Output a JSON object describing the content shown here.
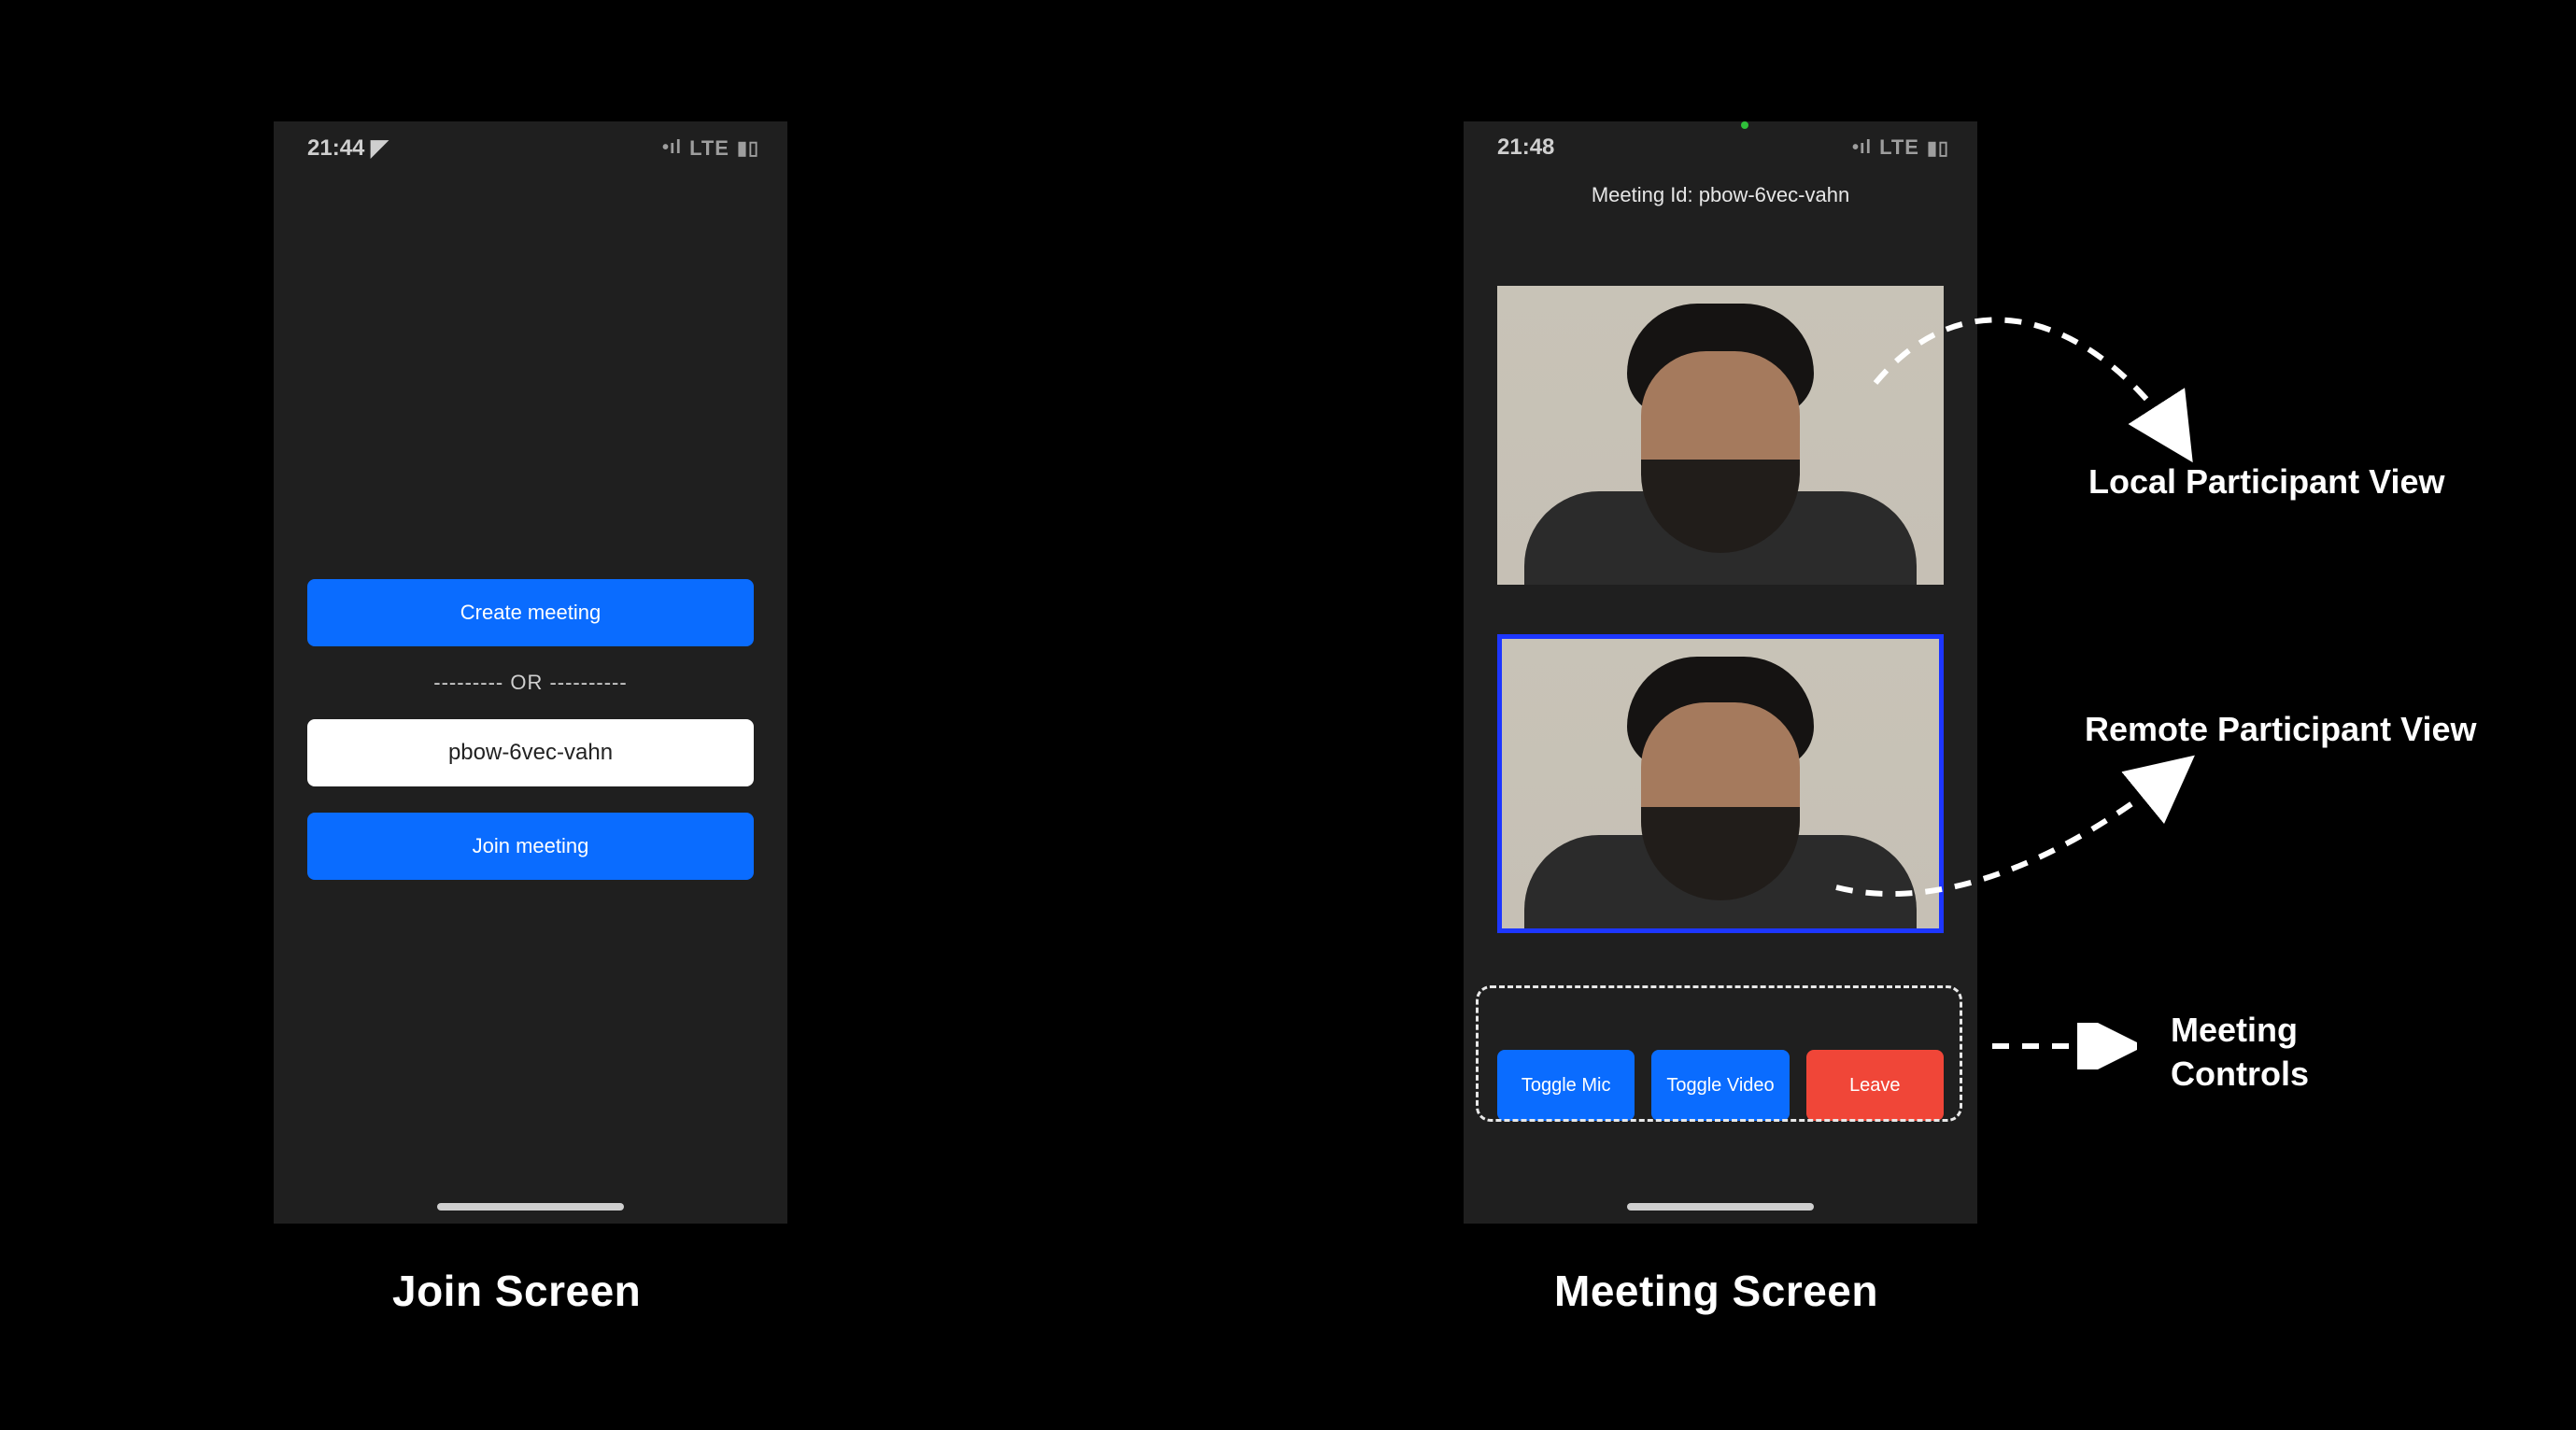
{
  "joinScreen": {
    "statusTime": "21:44",
    "statusNetwork": "LTE",
    "createButton": "Create meeting",
    "orText": "---------  OR  ----------",
    "meetingIdValue": "pbow-6vec-vahn",
    "joinButton": "Join meeting",
    "caption": "Join Screen"
  },
  "meetingScreen": {
    "statusTime": "21:48",
    "statusNetwork": "LTE",
    "meetingIdLabel": "Meeting Id: pbow-6vec-vahn",
    "controls": {
      "toggleMic": "Toggle Mic",
      "toggleVideo": "Toggle Video",
      "leave": "Leave"
    },
    "caption": "Meeting Screen"
  },
  "annotations": {
    "local": "Local Participant View",
    "remote": "Remote Participant View",
    "controls_l1": "Meeting",
    "controls_l2": "Controls"
  }
}
